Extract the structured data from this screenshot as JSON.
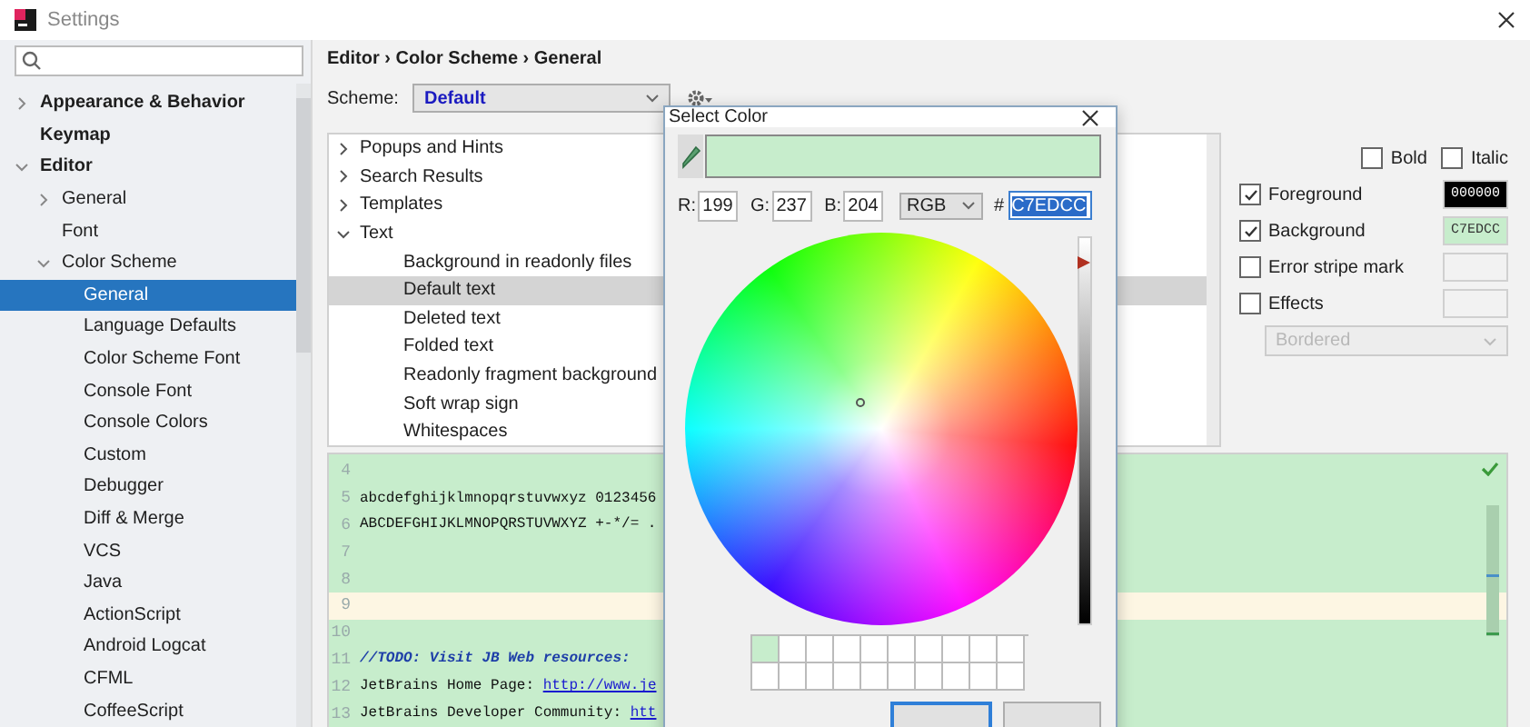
{
  "window": {
    "title": "Settings"
  },
  "sidebar": {
    "items": [
      {
        "label": "Appearance & Behavior",
        "expanded": false,
        "selected": false
      },
      {
        "label": "Keymap",
        "selected": false
      },
      {
        "label": "Editor",
        "expanded": true,
        "selected": false,
        "children": [
          {
            "label": "General",
            "expanded": false,
            "selected": false
          },
          {
            "label": "Font",
            "selected": false
          },
          {
            "label": "Color Scheme",
            "expanded": true,
            "selected": false,
            "children": [
              {
                "label": "General",
                "selected": true
              },
              {
                "label": "Language Defaults",
                "selected": false
              },
              {
                "label": "Color Scheme Font",
                "selected": false
              },
              {
                "label": "Console Font",
                "selected": false
              },
              {
                "label": "Console Colors",
                "selected": false
              },
              {
                "label": "Custom",
                "selected": false
              },
              {
                "label": "Debugger",
                "selected": false
              },
              {
                "label": "Diff & Merge",
                "selected": false
              },
              {
                "label": "VCS",
                "selected": false
              },
              {
                "label": "Java",
                "selected": false
              },
              {
                "label": "ActionScript",
                "selected": false
              },
              {
                "label": "Android Logcat",
                "selected": false
              },
              {
                "label": "CFML",
                "selected": false
              },
              {
                "label": "CoffeeScript",
                "selected": false
              }
            ]
          }
        ]
      }
    ]
  },
  "breadcrumb": "Editor › Color Scheme › General",
  "scheme": {
    "label": "Scheme:",
    "value": "Default"
  },
  "tree": [
    {
      "label": "Popups and Hints",
      "expanded": false,
      "selected": false
    },
    {
      "label": "Search Results",
      "expanded": false,
      "selected": false
    },
    {
      "label": "Templates",
      "expanded": false,
      "selected": false
    },
    {
      "label": "Text",
      "expanded": true,
      "selected": false,
      "children": [
        {
          "label": "Background in readonly files",
          "selected": false
        },
        {
          "label": "Default text",
          "selected": true
        },
        {
          "label": "Deleted text",
          "selected": false
        },
        {
          "label": "Folded text",
          "selected": false
        },
        {
          "label": "Readonly fragment background",
          "selected": false
        },
        {
          "label": "Soft wrap sign",
          "selected": false
        },
        {
          "label": "Whitespaces",
          "selected": false
        }
      ]
    }
  ],
  "attributes": {
    "font_styles": [
      {
        "label": "Bold",
        "checked": false
      },
      {
        "label": "Italic",
        "checked": false
      }
    ],
    "rows": [
      {
        "label": "Foreground",
        "checked": true,
        "value": "000000",
        "color": "#000000"
      },
      {
        "label": "Background",
        "checked": true,
        "value": "C7EDCC",
        "color": "#c7edcc"
      },
      {
        "label": "Error stripe mark",
        "checked": false
      },
      {
        "label": "Effects",
        "checked": false
      }
    ],
    "effect_type": {
      "value": "Bordered",
      "disabled": true
    }
  },
  "preview": {
    "lines": [
      {
        "number": "4",
        "current": false
      },
      {
        "number": "5",
        "current": false,
        "segments": [
          {
            "kind": "plain",
            "text": "abcdefghijklmnopqrstuvwxyz 0123456"
          }
        ]
      },
      {
        "number": "6",
        "current": false,
        "segments": [
          {
            "kind": "plain",
            "text": "ABCDEFGHIJKLMNOPQRSTUVWXYZ +-*/= ."
          }
        ]
      },
      {
        "number": "7",
        "current": false
      },
      {
        "number": "8",
        "current": false
      },
      {
        "number": "9",
        "current": true
      },
      {
        "number": "10",
        "current": false
      },
      {
        "number": "11",
        "current": false,
        "segments": [
          {
            "kind": "comment",
            "text": "//TODO: Visit JB Web resources:"
          }
        ]
      },
      {
        "number": "12",
        "current": false,
        "segments": [
          {
            "kind": "plain",
            "text": "JetBrains Home Page: "
          },
          {
            "kind": "link",
            "text": "http://www.je"
          }
        ]
      },
      {
        "number": "13",
        "current": false,
        "segments": [
          {
            "kind": "plain",
            "text": "JetBrains Developer Community: "
          },
          {
            "kind": "link",
            "text": "htt"
          }
        ]
      }
    ]
  },
  "dialog": {
    "title": "Select Color",
    "channels": [
      {
        "label": "R:",
        "value": "199"
      },
      {
        "label": "G:",
        "value": "237"
      },
      {
        "label": "B:",
        "value": "204"
      }
    ],
    "mode": "RGB",
    "hex_label": "#",
    "hex": "C7EDCC",
    "hex_selected": true,
    "brightness": {
      "level": 1
    },
    "recent_colors": [
      {
        "color": "#c7edcc"
      }
    ],
    "buttons": [
      {
        "default": true
      },
      {
        "default": false
      }
    ]
  }
}
